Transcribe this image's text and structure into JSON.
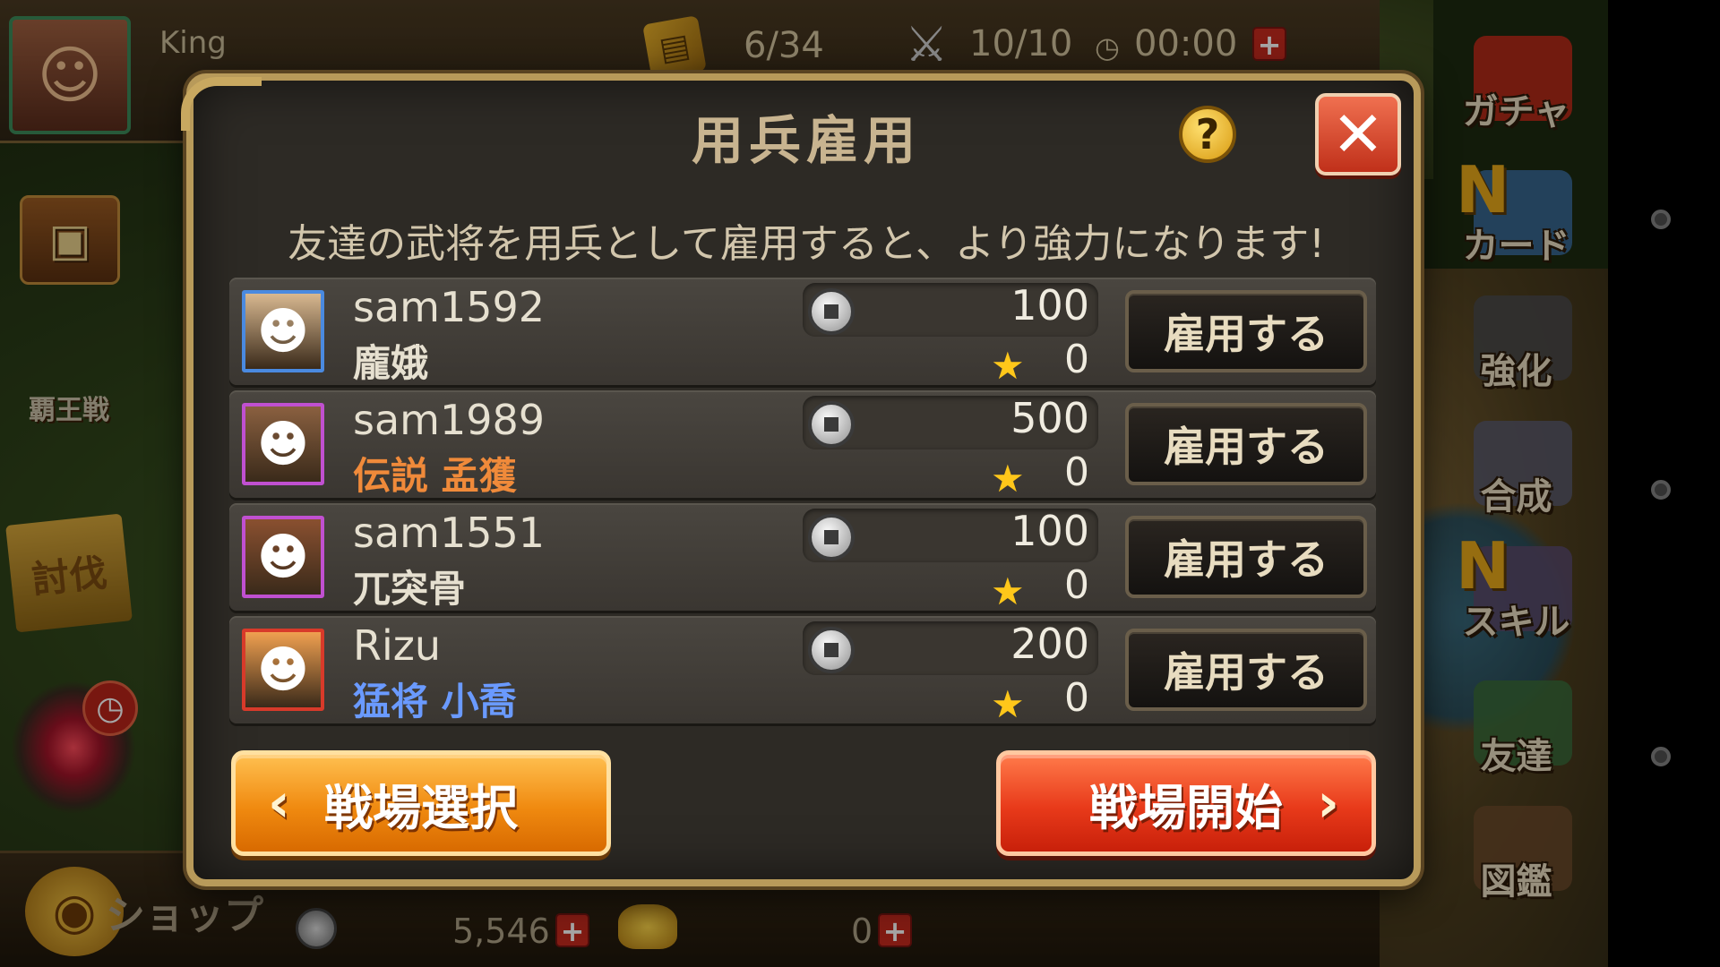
{
  "hud": {
    "player_name": "King",
    "ticket": "6/34",
    "stamina": "10/10",
    "timer": "00:00",
    "icons": {
      "avatar": "general-portrait",
      "ticket": "ticket-icon",
      "swords": "crossed-swords-icon",
      "clock": "clock-icon"
    }
  },
  "left_menu": {
    "haou_label": "覇王戦",
    "touba_label": "討伐"
  },
  "right_menu": [
    {
      "label": "ガチャ",
      "icon": "gacha-icon",
      "color": "#c02a1a"
    },
    {
      "label": "カード",
      "icon": "card-icon",
      "color": "#3a6a9a",
      "badge": "N"
    },
    {
      "label": "強化",
      "icon": "hammer-icon",
      "color": "#4a4a4a"
    },
    {
      "label": "合成",
      "icon": "synthesis-icon",
      "color": "#5a5a6a"
    },
    {
      "label": "スキル",
      "icon": "skill-icon",
      "color": "#5a4a6a",
      "badge": "N"
    },
    {
      "label": "友達",
      "icon": "handshake-icon",
      "color": "#3a6a3a"
    },
    {
      "label": "図鑑",
      "icon": "book-icon",
      "color": "#6a4a2a"
    }
  ],
  "bottom_bar": {
    "shop_label": "ショップ",
    "coins": "5,546",
    "gold": "0"
  },
  "dialog": {
    "title": "用兵雇用",
    "description": "友達の武将を用兵として雇用すると、より強力になります!",
    "help_label": "?",
    "close_label": "✕",
    "hire_label": "雇用する",
    "select_label": "戦場選択",
    "start_label": "戦場開始",
    "mercenaries": [
      {
        "name": "sam1592",
        "title": "龐娥",
        "title_color": "#e6e0d0",
        "frame_color": "#4a8ae0",
        "cost": "100",
        "stars": "0",
        "portrait_bg": "#d8b890"
      },
      {
        "name": "sam1989",
        "title": "伝説 孟獲",
        "title_color": "#f08a3a",
        "frame_color": "#c050d0",
        "cost": "500",
        "stars": "0",
        "portrait_bg": "#8a6040"
      },
      {
        "name": "sam1551",
        "title": "兀突骨",
        "title_color": "#e6e0d0",
        "frame_color": "#c050d0",
        "cost": "100",
        "stars": "0",
        "portrait_bg": "#8a5030"
      },
      {
        "name": "Rizu",
        "title": "猛将 小喬",
        "title_color": "#6a9aff",
        "frame_color": "#d83a2a",
        "cost": "200",
        "stars": "0",
        "portrait_bg": "#f0a050"
      }
    ]
  }
}
